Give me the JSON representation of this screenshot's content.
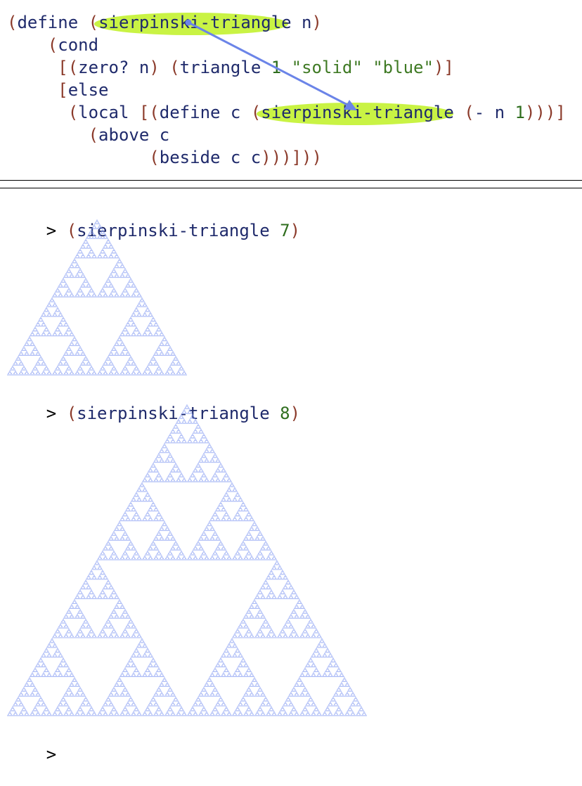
{
  "editor": {
    "lines": [
      [
        {
          "t": "(",
          "c": "paren"
        },
        {
          "t": "define",
          "c": "kw"
        },
        {
          "t": " ",
          "c": "id"
        },
        {
          "t": "(",
          "c": "paren"
        },
        {
          "t": "sierpinski-triangle",
          "c": "id"
        },
        {
          "t": " n",
          "c": "id"
        },
        {
          "t": ")",
          "c": "paren"
        }
      ],
      [
        {
          "t": "    ",
          "c": "id"
        },
        {
          "t": "(",
          "c": "paren"
        },
        {
          "t": "cond",
          "c": "kw"
        }
      ],
      [
        {
          "t": "     ",
          "c": "id"
        },
        {
          "t": "[(",
          "c": "paren"
        },
        {
          "t": "zero? n",
          "c": "id"
        },
        {
          "t": ")",
          "c": "paren"
        },
        {
          "t": " ",
          "c": "id"
        },
        {
          "t": "(",
          "c": "paren"
        },
        {
          "t": "triangle ",
          "c": "id"
        },
        {
          "t": "1",
          "c": "num"
        },
        {
          "t": " ",
          "c": "id"
        },
        {
          "t": "\"solid\"",
          "c": "str"
        },
        {
          "t": " ",
          "c": "id"
        },
        {
          "t": "\"blue\"",
          "c": "str"
        },
        {
          "t": ")]",
          "c": "paren"
        }
      ],
      [
        {
          "t": "     ",
          "c": "id"
        },
        {
          "t": "[",
          "c": "paren"
        },
        {
          "t": "else",
          "c": "kw"
        }
      ],
      [
        {
          "t": "      ",
          "c": "id"
        },
        {
          "t": "(",
          "c": "paren"
        },
        {
          "t": "local",
          "c": "kw"
        },
        {
          "t": " ",
          "c": "id"
        },
        {
          "t": "[(",
          "c": "paren"
        },
        {
          "t": "define",
          "c": "kw"
        },
        {
          "t": " c ",
          "c": "id"
        },
        {
          "t": "(",
          "c": "paren"
        },
        {
          "t": "sierpinski-triangle",
          "c": "id"
        },
        {
          "t": " ",
          "c": "id"
        },
        {
          "t": "(",
          "c": "paren"
        },
        {
          "t": "- n ",
          "c": "id"
        },
        {
          "t": "1",
          "c": "num"
        },
        {
          "t": ")))]",
          "c": "paren"
        }
      ],
      [
        {
          "t": "        ",
          "c": "id"
        },
        {
          "t": "(",
          "c": "paren"
        },
        {
          "t": "above c",
          "c": "id"
        }
      ],
      [
        {
          "t": "              ",
          "c": "id"
        },
        {
          "t": "(",
          "c": "paren"
        },
        {
          "t": "beside c c",
          "c": "id"
        },
        {
          "t": ")))]))",
          "c": "paren"
        }
      ]
    ]
  },
  "repl": {
    "prompt_symbol": ">",
    "interactions": [
      {
        "open": "(",
        "fn": "sierpinski-triangle",
        "arg": "7",
        "close": ")"
      },
      {
        "open": "(",
        "fn": "sierpinski-triangle",
        "arg": "8",
        "close": ")"
      }
    ],
    "final_prompt": ">"
  },
  "colors": {
    "triangle_fill": "#8aa0f2",
    "highlight": "#c6f23a",
    "arrow": "#6b84e8"
  },
  "icons": [
    "binding-arrow-icon"
  ]
}
